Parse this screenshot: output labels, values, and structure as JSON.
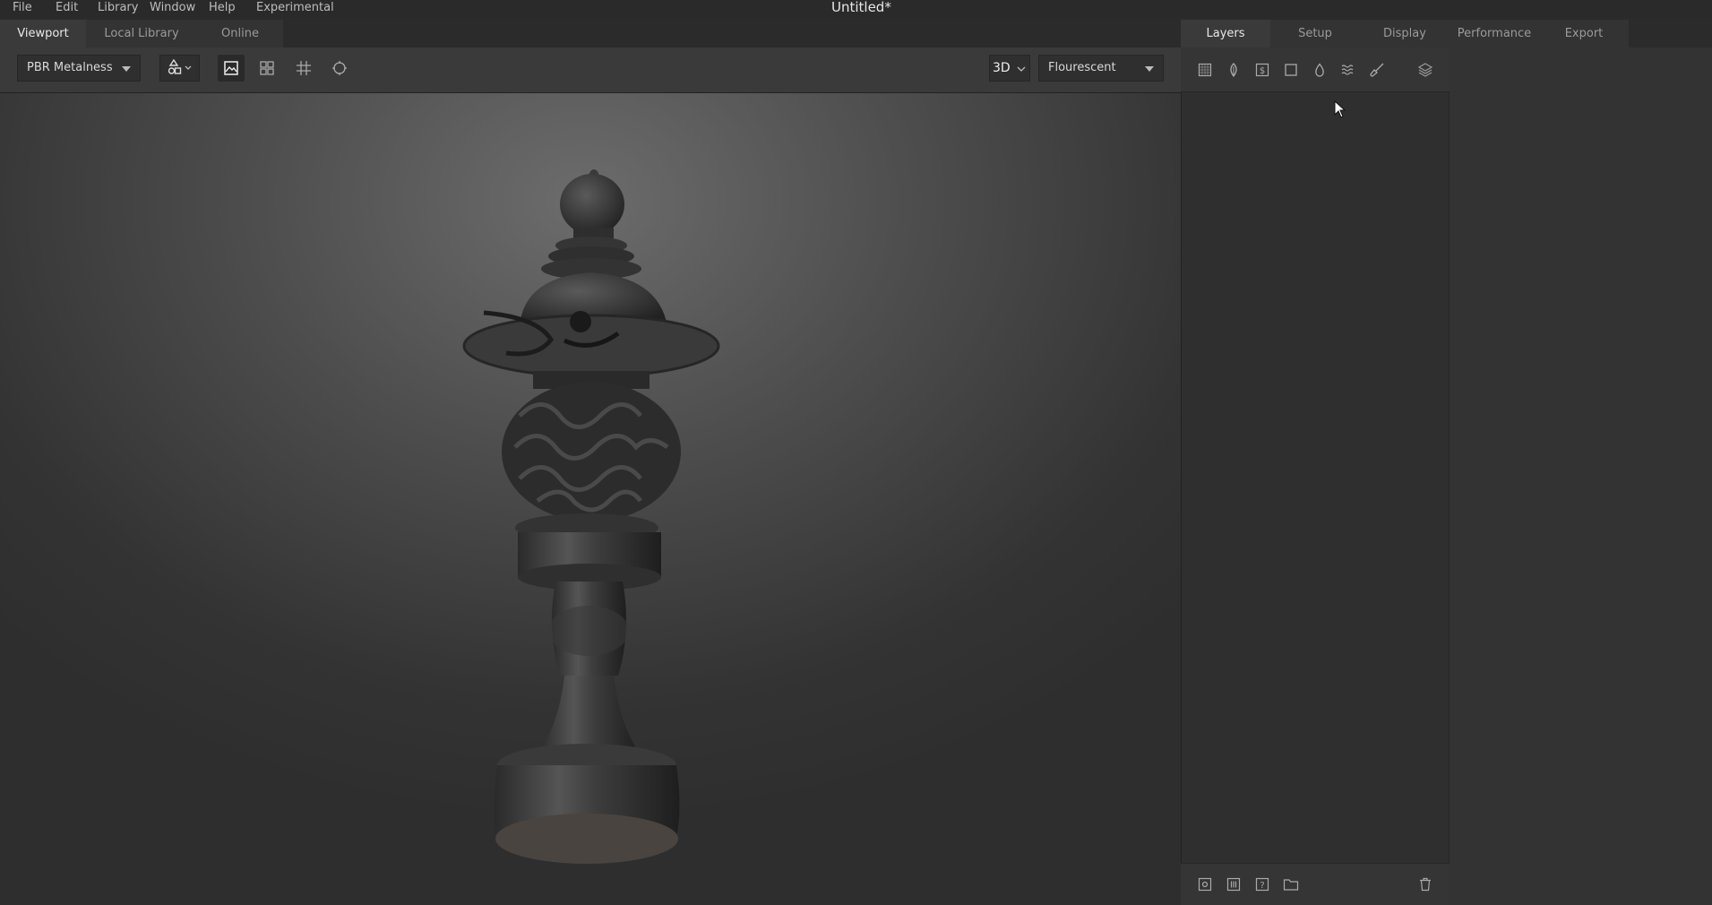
{
  "menu": [
    "File",
    "Edit",
    "Library",
    "Window",
    "Help",
    "Experimental"
  ],
  "window_title": "Untitled*",
  "left_tabs": [
    "Viewport",
    "Local Library",
    "Online"
  ],
  "right_tabs": [
    "Layers",
    "Setup",
    "Display",
    "Performance",
    "Export"
  ],
  "toolbar": {
    "shader_select": "PBR Metalness",
    "view_mode": "3D",
    "environment_select": "Flourescent"
  },
  "layer_tool_icons": [
    "fill-layer-icon",
    "leaf-icon",
    "dollar-icon",
    "square-icon",
    "drop-icon",
    "waves-icon",
    "brush-icon",
    "layers-icon"
  ],
  "bottom_icons": [
    "add-layer-icon",
    "add-group-icon",
    "help-icon",
    "folder-icon",
    "trash-icon"
  ],
  "colors": {
    "panel_bg": "#2f2f2f",
    "viewport_center": "#6c6c6c",
    "text": "#c8c8c8"
  }
}
